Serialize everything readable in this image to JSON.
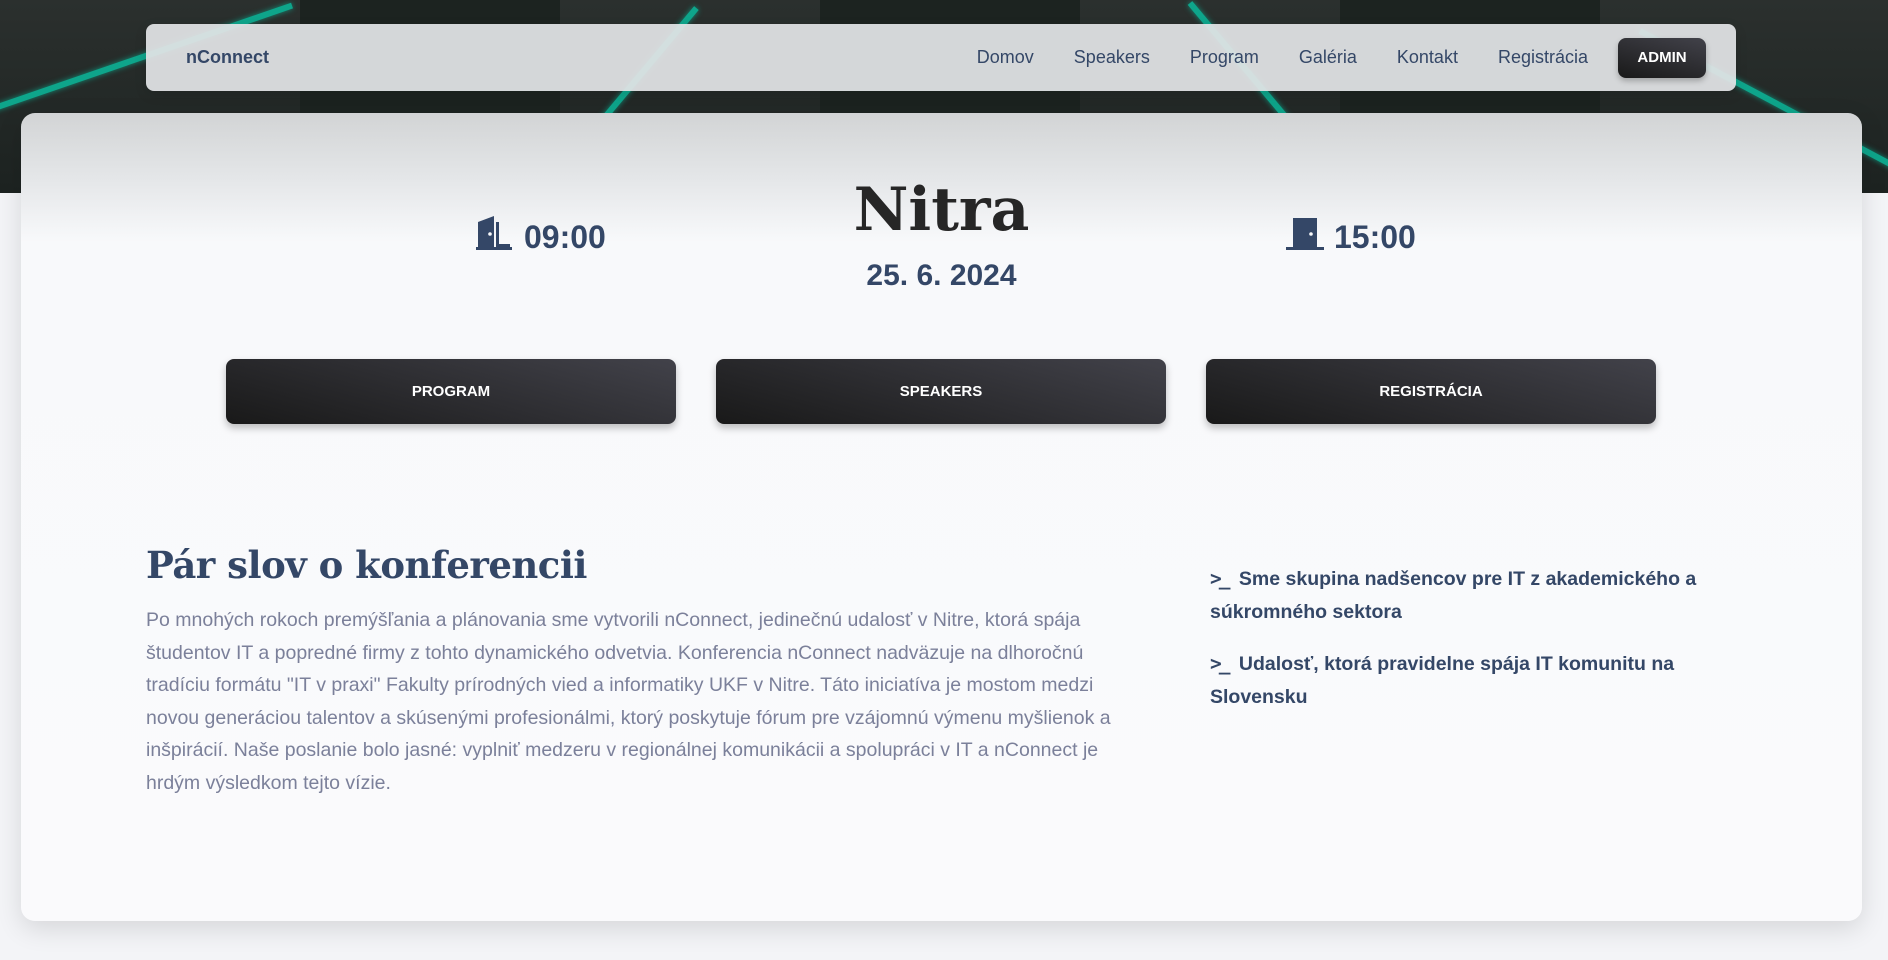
{
  "navbar": {
    "brand": "nConnect",
    "links": [
      "Domov",
      "Speakers",
      "Program",
      "Galéria",
      "Kontakt",
      "Registrácia"
    ],
    "admin_label": "ADMIN"
  },
  "event": {
    "start_time": "09:00",
    "end_time": "15:00",
    "city": "Nitra",
    "date": "25. 6. 2024"
  },
  "actions": {
    "program": "PROGRAM",
    "speakers": "SPEAKERS",
    "registration": "REGISTRÁCIA"
  },
  "about": {
    "title": "Pár slov o konferencii",
    "text": "Po mnohých rokoch premýšľania a plánovania sme vytvorili nConnect, jedinečnú udalosť v Nitre, ktorá spája študentov IT a popredné firmy z tohto dynamického odvetvia. Konferencia nConnect nadväzuje na dlhoročnú tradíciu formátu \"IT v praxi\" Fakulty prírodných vied a informatiky UKF v Nitre. Táto iniciatíva je mostom medzi novou generáciou talentov a skúsenými profesionálmi, ktorý poskytuje fórum pre vzájomnú výmenu myšlienok a inšpirácií. Naše poslanie bolo jasné: vyplniť medzeru v regionálnej komunikácii a spolupráci v IT a nConnect je hrdým výsledkom tejto vízie.",
    "features": [
      "Sme skupina nadšencov pre IT z akademického a súkromného sektora",
      "Udalosť, ktorá pravidelne spája IT komunitu na Slovensku"
    ]
  },
  "icons": {
    "start": "door-open-icon",
    "end": "door-closed-icon",
    "feature": "terminal-prompt-icon"
  }
}
